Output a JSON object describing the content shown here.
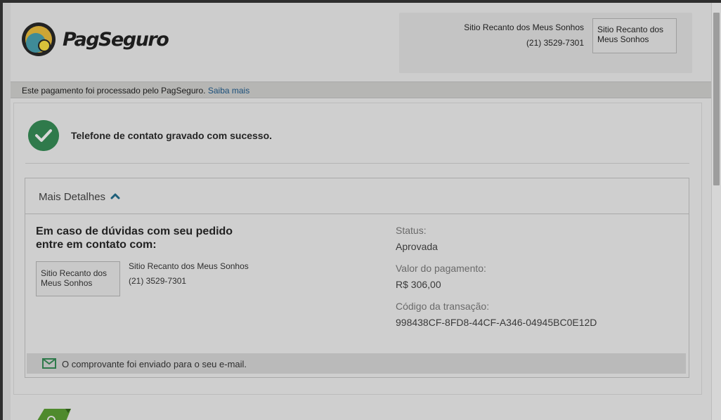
{
  "header": {
    "logo_text": "PagSeguro",
    "seller_name": "Sitio Recanto dos Meus Sonhos",
    "seller_phone": "(21) 3529-7301",
    "seller_logo_text": "Sitio Recanto dos Meus Sonhos"
  },
  "info_bar": {
    "text": "Este pagamento foi processado pelo PagSeguro.",
    "link_text": "Saiba mais"
  },
  "notification": {
    "message": "Telefone de contato gravado com sucesso."
  },
  "details": {
    "title": "Mais Detalhes",
    "contact_heading": "Em caso de dúvidas com seu pedido entre em contato com:",
    "contact_logo_text": "Sitio Recanto dos Meus Sonhos",
    "contact_name": "Sitio Recanto dos Meus Sonhos",
    "contact_phone": "(21) 3529-7301",
    "status_label": "Status:",
    "status_value": "Aprovada",
    "amount_label": "Valor do pagamento:",
    "amount_value": "R$ 306,00",
    "transaction_label": "Código da transação:",
    "transaction_value": "998438CF-8FD8-44CF-A346-04945BC0E12D",
    "receipt_text": "O comprovante foi enviado para o seu e-mail."
  },
  "colors": {
    "success": "#2f7a4b",
    "link": "#1b4f7a",
    "accent": "#1d5f7a",
    "ribbon": "#4f8a2d"
  },
  "icons": [
    "pagseguro-logo-icon",
    "check-circle-icon",
    "chevron-up-icon",
    "mail-icon",
    "ribbon-icon"
  ]
}
